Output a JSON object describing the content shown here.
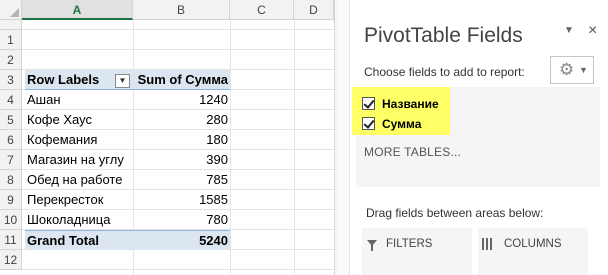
{
  "sheet": {
    "columns": [
      "A",
      "B",
      "C",
      "D"
    ],
    "rows": [
      "1",
      "2",
      "3",
      "4",
      "5",
      "6",
      "7",
      "8",
      "9",
      "10",
      "11",
      "12"
    ],
    "pivot": {
      "header_label": "Row Labels",
      "header_value": "Sum of Сумма",
      "items": [
        {
          "label": "Ашан",
          "value": "1240"
        },
        {
          "label": "Кофе Хаус",
          "value": "280"
        },
        {
          "label": "Кофемания",
          "value": "180"
        },
        {
          "label": "Магазин на углу",
          "value": "390"
        },
        {
          "label": "Обед на работе",
          "value": "785"
        },
        {
          "label": "Перекресток",
          "value": "1585"
        },
        {
          "label": "Шоколадница",
          "value": "780"
        }
      ],
      "total_label": "Grand Total",
      "total_value": "5240"
    },
    "filter_glyph": "▼"
  },
  "panel": {
    "title": "PivotTable Fields",
    "title_caret": "▼",
    "close_glyph": "×",
    "choose_text": "Choose fields to add to report:",
    "gear_glyph": "⚙",
    "gear_caret": "▼",
    "fields": [
      {
        "label": "Название",
        "checked": true
      },
      {
        "label": "Сумма",
        "checked": true
      }
    ],
    "more_tables": "MORE TABLES...",
    "drag_text": "Drag fields between areas below:",
    "areas": {
      "filters": "FILTERS",
      "columns": "COLUMNS"
    },
    "highlight_color": "#ffff66"
  },
  "colors": {
    "accent": "#217346",
    "pivot_header_bg": "#dce6f1"
  }
}
